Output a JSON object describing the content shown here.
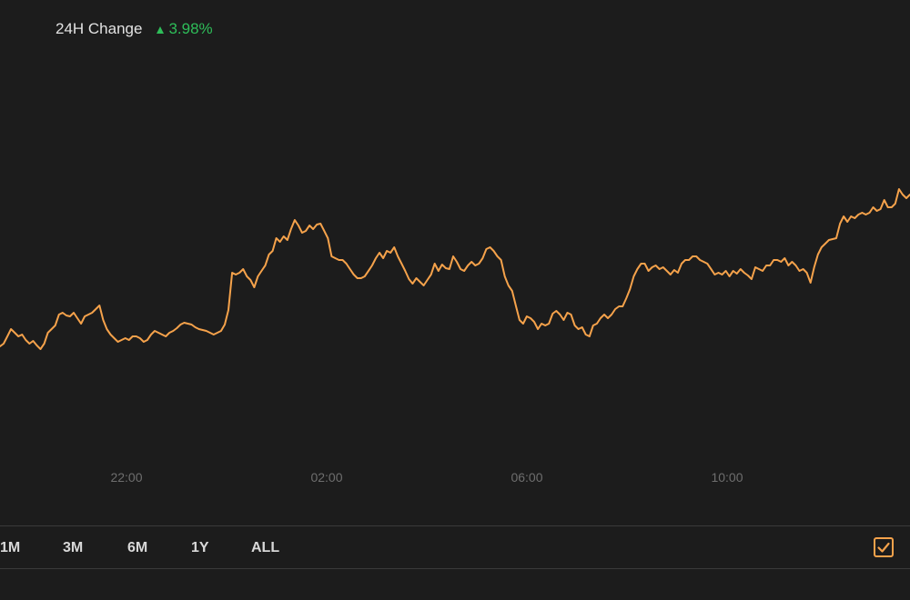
{
  "header": {
    "change_label": "24H Change",
    "change_value": "3.98%",
    "change_direction": "up",
    "change_color": "#2ebd59"
  },
  "range_tabs": [
    "1M",
    "3M",
    "6M",
    "1Y",
    "ALL"
  ],
  "checkbox": {
    "icon": "checked-checkbox-icon",
    "color": "#f5a24b",
    "checked": true
  },
  "colors": {
    "background": "#1c1c1c",
    "line": "#f5a24b",
    "axis_text": "#6e6e6e",
    "divider": "#3a3a3a"
  },
  "chart_data": {
    "type": "line",
    "title": "",
    "xlabel": "",
    "ylabel": "",
    "x_ticks": [
      "22:00",
      "02:00",
      "06:00",
      "10:00"
    ],
    "grid": false,
    "legend": "none",
    "series": [
      {
        "values": [
          381,
          378,
          370,
          362,
          366,
          370,
          368,
          374,
          378,
          375,
          380,
          384,
          378,
          366,
          362,
          358,
          346,
          344,
          347,
          348,
          344,
          350,
          356,
          348,
          346,
          344,
          340,
          336,
          352,
          362,
          368,
          372,
          376,
          374,
          372,
          374,
          370,
          370,
          372,
          376,
          374,
          368,
          364,
          366,
          368,
          370,
          366,
          364,
          361,
          357,
          355,
          356,
          357,
          360,
          362,
          363,
          364,
          366,
          368,
          366,
          364,
          357,
          341,
          300,
          302,
          300,
          296,
          304,
          308,
          316,
          304,
          298,
          292,
          280,
          276,
          262,
          266,
          260,
          264,
          252,
          242,
          248,
          256,
          254,
          248,
          252,
          247,
          246,
          254,
          262,
          282,
          284,
          286,
          286,
          290,
          296,
          302,
          306,
          306,
          304,
          298,
          292,
          284,
          278,
          284,
          276,
          278,
          272,
          282,
          290,
          298,
          307,
          312,
          306,
          310,
          314,
          308,
          302,
          290,
          298,
          291,
          295,
          296,
          282,
          288,
          296,
          298,
          292,
          288,
          292,
          290,
          284,
          274,
          272,
          276,
          282,
          286,
          304,
          314,
          320,
          336,
          352,
          356,
          348,
          350,
          354,
          362,
          356,
          358,
          356,
          345,
          342,
          346,
          352,
          344,
          346,
          358,
          362,
          360,
          368,
          370,
          358,
          356,
          350,
          346,
          350,
          346,
          340,
          337,
          337,
          328,
          318,
          304,
          296,
          290,
          290,
          298,
          294,
          292,
          296,
          294,
          298,
          302,
          297,
          300,
          290,
          286,
          286,
          282,
          282,
          286,
          288,
          290,
          296,
          302,
          300,
          302,
          298,
          304,
          298,
          301,
          296,
          300,
          303,
          307,
          294,
          296,
          298,
          292,
          292,
          286,
          286,
          288,
          284,
          292,
          288,
          292,
          298,
          296,
          300,
          311,
          294,
          280,
          272,
          268,
          264,
          263,
          262,
          246,
          238,
          244,
          238,
          240,
          236,
          234,
          236,
          234,
          228,
          232,
          230,
          220,
          228,
          228,
          224,
          208,
          214,
          218,
          214
        ]
      }
    ]
  }
}
